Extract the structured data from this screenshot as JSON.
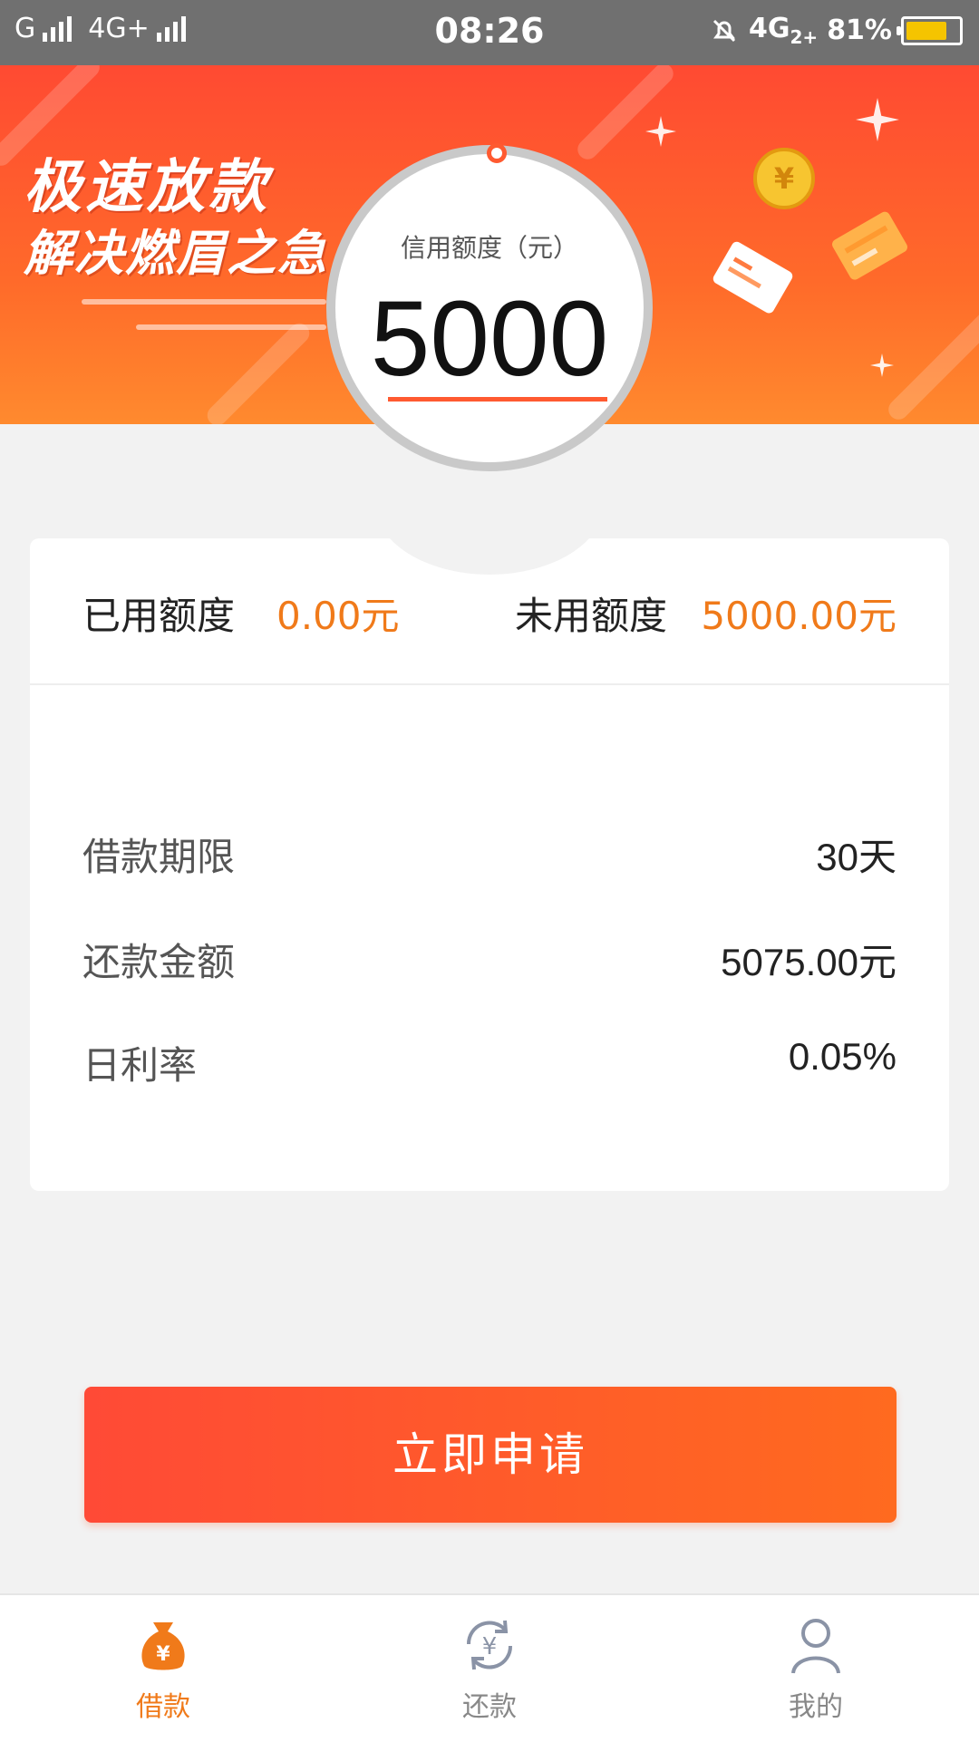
{
  "status_bar": {
    "left_net1": "G",
    "left_net2": "4G+",
    "time": "08:26",
    "right_net": "4G",
    "right_net_sub": "2+",
    "battery_text": "81%",
    "battery_level": 0.81
  },
  "banner": {
    "slogan_line1": "极速放款",
    "slogan_line2": "解决燃眉之急",
    "credit_label": "信用额度（元）",
    "credit_amount": "5000"
  },
  "quota": {
    "used_label": "已用额度",
    "used_value": "0.00元",
    "unused_label": "未用额度",
    "unused_value": "5000.00元"
  },
  "loan_info": [
    {
      "label": "借款期限",
      "value": "30天"
    },
    {
      "label": "还款金额",
      "value": "5075.00元"
    },
    {
      "label": "日利率",
      "value": "0.05%"
    }
  ],
  "apply_button": "立即申请",
  "nav": {
    "items": [
      {
        "label": "借款",
        "icon": "money-bag-icon",
        "active": true
      },
      {
        "label": "还款",
        "icon": "repay-cycle-icon",
        "active": false
      },
      {
        "label": "我的",
        "icon": "user-icon",
        "active": false
      }
    ]
  },
  "colors": {
    "accent": "#ff5a30",
    "value_orange": "#f07a1a",
    "status_bar": "#707070"
  }
}
